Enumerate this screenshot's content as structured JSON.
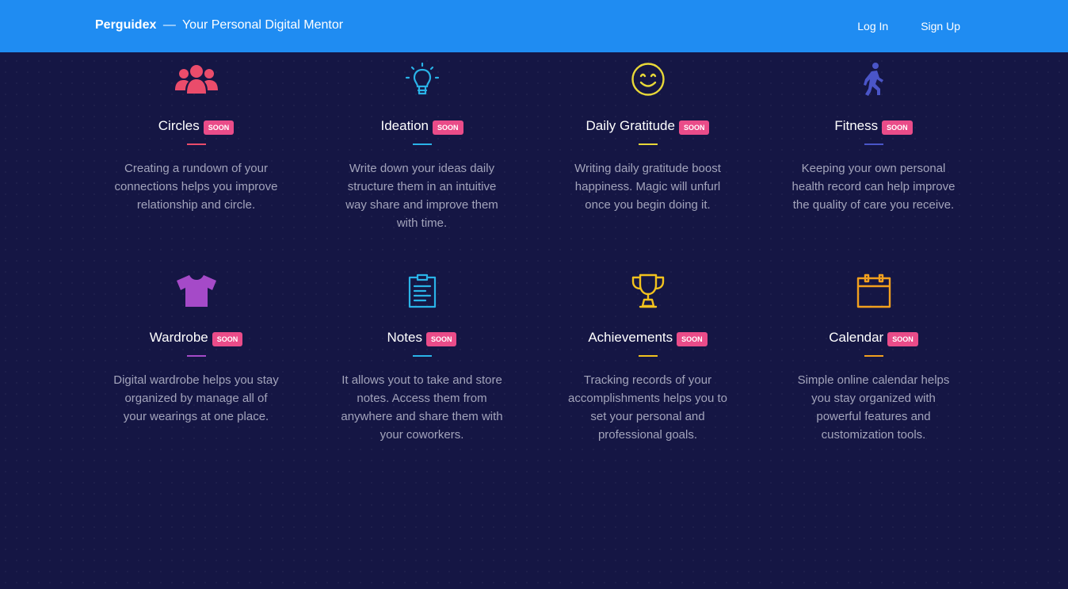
{
  "nav": {
    "brand_name": "Perguidex",
    "brand_separator": "—",
    "tagline": "Your Personal Digital Mentor",
    "login_label": "Log In",
    "signup_label": "Sign Up"
  },
  "colors": {
    "navbar": "#1f8cf2",
    "background": "#151644",
    "badge": "#ea4c89",
    "circles": "#ea4c6b",
    "ideation": "#2ab3e8",
    "gratitude": "#e8d838",
    "fitness": "#4a55c8",
    "wardrobe": "#a54ac8",
    "notes": "#2ab3e8",
    "achievements": "#f2c21e",
    "calendar": "#f2a01e"
  },
  "features": [
    {
      "title": "Circles",
      "badge": "SOON",
      "icon": "users-icon",
      "description": "Creating a rundown of your connections helps you improve relationship and circle."
    },
    {
      "title": "Ideation",
      "badge": "SOON",
      "icon": "lightbulb-icon",
      "description": "Write down your ideas daily structure them in an intuitive way share and improve them with time."
    },
    {
      "title": "Daily Gratitude",
      "badge": "SOON",
      "icon": "smile-icon",
      "description": "Writing daily gratitude boost happiness. Magic will unfurl once you begin doing it."
    },
    {
      "title": "Fitness",
      "badge": "SOON",
      "icon": "walking-icon",
      "description": "Keeping your own personal health record can help improve the quality of care you receive."
    },
    {
      "title": "Wardrobe",
      "badge": "SOON",
      "icon": "tshirt-icon",
      "description": "Digital wardrobe helps you stay organized by manage all of your wearings at one place."
    },
    {
      "title": "Notes",
      "badge": "SOON",
      "icon": "clipboard-icon",
      "description": "It allows yout to take and store notes. Access them from anywhere and share them with your coworkers."
    },
    {
      "title": "Achievements",
      "badge": "SOON",
      "icon": "trophy-icon",
      "description": "Tracking records of your accomplishments helps you to set your personal and professional goals."
    },
    {
      "title": "Calendar",
      "badge": "SOON",
      "icon": "calendar-icon",
      "description": "Simple online calendar helps you stay organized with powerful features and customization tools."
    }
  ]
}
